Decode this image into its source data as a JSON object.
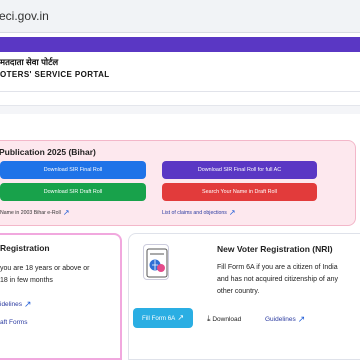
{
  "browser": {
    "url": "eci.gov.in"
  },
  "portal": {
    "hindi_title": "मतदाता सेवा पोर्टल",
    "english_title": "OTERS' SERVICE PORTAL"
  },
  "sir_section": {
    "title": "Publication 2025 (Bihar)",
    "buttons": {
      "download_final_roll": "Download SIR Final Roll",
      "download_final_roll_ac": "Download SIR Final Roll for full AC",
      "download_draft_roll": "Download SIR Draft Roll",
      "search_name_draft": "Search Your Name in Draft Roll"
    },
    "links": {
      "name_2003": "Name in 2003 Bihar e-Roll",
      "claims_objections": "List of claims and objections"
    }
  },
  "registration_card": {
    "title": "Registration",
    "desc_line1": "you are 18 years or above or",
    "desc_line2": "18 in few months",
    "guidelines": "idelines",
    "forms": "aft Forms"
  },
  "nri_card": {
    "title": "New Voter Registration (NRI)",
    "desc_line1": "Fill Form 6A if you are a citizen of India",
    "desc_line2": "and has not acquired citizenship of any",
    "desc_line3": "other country.",
    "fill_button": "Fill Form 6A",
    "download": "Download",
    "guidelines": "Guidelines"
  },
  "colors": {
    "brand_purple": "#5a37c4",
    "blue": "#1f73e8",
    "green": "#18a24b",
    "red": "#e23b3b",
    "cyan": "#2aaee3",
    "pink_bg": "#fde8ee"
  }
}
